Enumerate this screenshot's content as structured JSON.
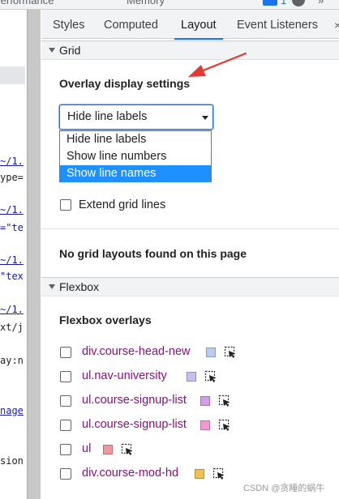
{
  "toolbar": {
    "items": [
      "Performance",
      "Memory"
    ],
    "issues_count": "1",
    "more": "»"
  },
  "code_pane": {
    "lines": [
      {
        "text": "~/1.",
        "kind": "link"
      },
      {
        "text": "ype=",
        "kind": "attr"
      },
      {
        "text": "~/1.",
        "kind": "link"
      },
      {
        "text": "=\"te",
        "kind": "str"
      },
      {
        "text": "~/1.",
        "kind": "link"
      },
      {
        "text": "\"tex",
        "kind": "str"
      },
      {
        "text": "~/1.",
        "kind": "link"
      },
      {
        "text": "xt/j",
        "kind": "attr"
      },
      {
        "text": "ay:n",
        "kind": "attr"
      },
      {
        "text": "nage",
        "kind": "link"
      },
      {
        "text": "sion",
        "kind": "attr"
      }
    ]
  },
  "tabs": {
    "items": [
      {
        "label": "Styles",
        "active": false
      },
      {
        "label": "Computed",
        "active": false
      },
      {
        "label": "Layout",
        "active": true
      },
      {
        "label": "Event Listeners",
        "active": false
      }
    ],
    "overflow": "×"
  },
  "grid": {
    "section_title": "Grid",
    "overlay_heading": "Overlay display settings",
    "select_value": "Hide line labels",
    "options": [
      {
        "label": "Hide line labels",
        "selected": false
      },
      {
        "label": "Show line numbers",
        "selected": false
      },
      {
        "label": "Show line names",
        "selected": true
      }
    ],
    "extend_label": "Extend grid lines",
    "extend_checked": false,
    "no_layouts": "No grid layouts found on this page"
  },
  "flexbox": {
    "section_title": "Flexbox",
    "overlays_heading": "Flexbox overlays",
    "items": [
      {
        "label": "div.course-head-new",
        "color": "#b9cdf0"
      },
      {
        "label": "ul.nav-university",
        "color": "#c9bfee"
      },
      {
        "label": "ul.course-signup-list",
        "color": "#d59ee6"
      },
      {
        "label": "ul.course-signup-list",
        "color": "#f09bd4"
      },
      {
        "label": "ul",
        "color": "#f0999c"
      },
      {
        "label": "div.course-mod-hd",
        "color": "#f0c050"
      }
    ]
  },
  "colors": {
    "accent": "#1a73e8",
    "annotation_arrow": "#e53935",
    "selector_text": "#881280"
  },
  "watermark": "CSDN @贪睡的蜗牛"
}
